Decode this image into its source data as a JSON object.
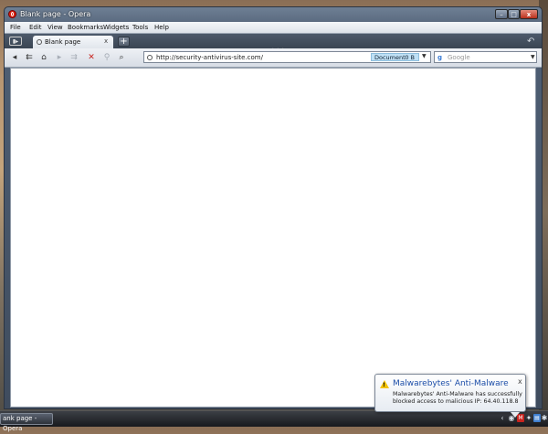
{
  "window": {
    "title": "Blank page - Opera",
    "min_glyph": "–",
    "max_glyph": "□",
    "close_glyph": "x"
  },
  "menu": [
    "File",
    "Edit",
    "View",
    "Bookmarks",
    "Widgets",
    "Tools",
    "Help"
  ],
  "tabbar": {
    "panel_toggle": "▮▸",
    "tab_label": "Blank page",
    "tab_close": "x",
    "new_tab": "+",
    "dots": "• • •",
    "trash": "↶"
  },
  "toolbar": {
    "back": "◂",
    "rewind": "⇇",
    "home": "⌂",
    "forward": "▸",
    "fast_forward": "⇉",
    "stop": "✕",
    "wand": "⚲",
    "zoom": "⌕"
  },
  "address": {
    "url": "http://security-antivirus-site.com/",
    "doc_label": "Document",
    "doc_size": "0 B"
  },
  "search": {
    "engine_icon": "g",
    "placeholder": "Google"
  },
  "taskbar": {
    "task_label": "ank page - Opera",
    "tray": [
      "‹",
      "◉",
      "M",
      "✦",
      "▤",
      "✱"
    ]
  },
  "notification": {
    "title": "Malwarebytes' Anti-Malware",
    "message": "Malwarebytes' Anti-Malware has successfully blocked access to malicious IP: 64.40.118.8",
    "close": "x",
    "warning_glyph": "!"
  }
}
